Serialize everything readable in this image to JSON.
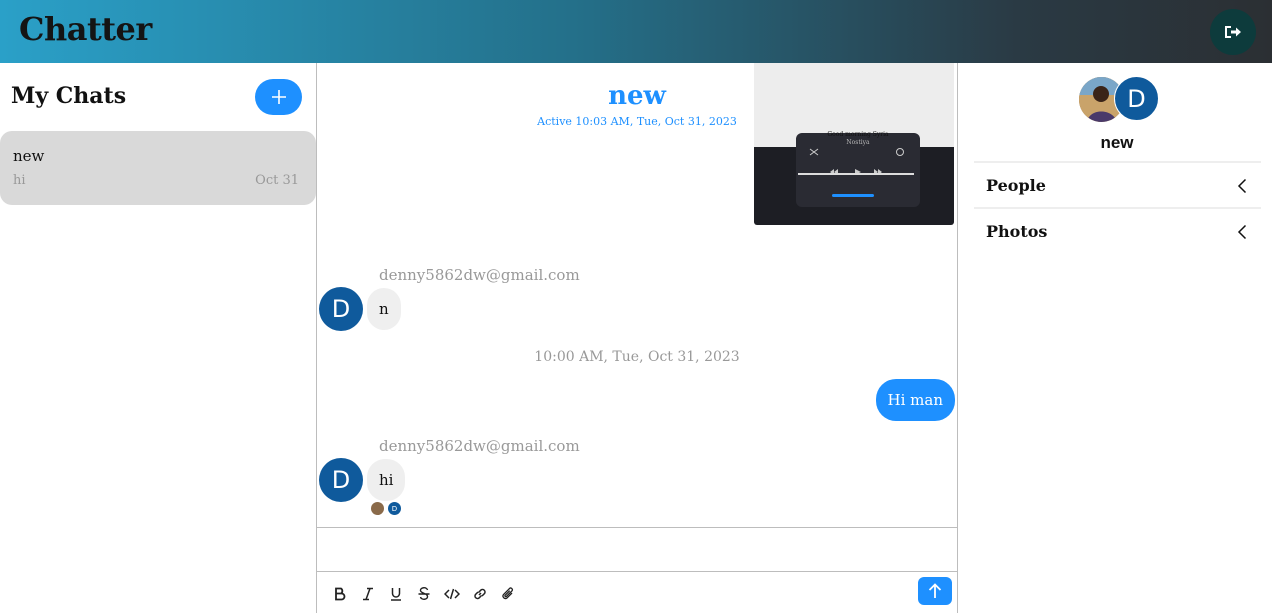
{
  "app": {
    "title": "Chatter"
  },
  "sidebar": {
    "title": "My Chats",
    "chats": [
      {
        "name": "new",
        "preview": "hi",
        "date": "Oct 31"
      }
    ]
  },
  "conversation": {
    "title": "new",
    "active_status": "Active 10:03 AM, Tue, Oct 31, 2023",
    "shared_image": {
      "caption": "Good morning Syria",
      "subtitle": "Nostiya"
    },
    "messages": [
      {
        "sender": "denny5862dw@gmail.com",
        "avatar_letter": "D",
        "text": "n",
        "direction": "incoming"
      },
      {
        "timestamp": "10:00 AM, Tue, Oct 31, 2023"
      },
      {
        "text": "Hi man",
        "direction": "outgoing"
      },
      {
        "sender": "denny5862dw@gmail.com",
        "avatar_letter": "D",
        "text": "hi",
        "direction": "incoming"
      }
    ],
    "input": {
      "value": "",
      "placeholder": ""
    }
  },
  "details": {
    "avatar_letter": "D",
    "name": "new",
    "sections": [
      {
        "label": "People"
      },
      {
        "label": "Photos"
      }
    ]
  },
  "colors": {
    "accent": "#1e90ff",
    "avatar": "#0f5a9c",
    "logout": "#0d3b3c"
  }
}
